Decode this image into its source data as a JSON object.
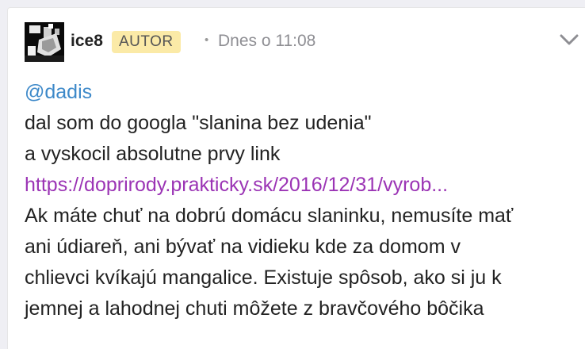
{
  "post": {
    "author": {
      "username": "ice8",
      "badge": "AUTOR"
    },
    "separator": "•",
    "timestamp": "Dnes o 11:08",
    "body": {
      "mention": "@dadis",
      "line1": "dal som do googla \"slanina bez udenia\"",
      "line2": "a vyskocil absolutne prvy link",
      "link_text": "https://doprirody.prakticky.sk/2016/12/31/vyrob...",
      "line3": "Ak máte chuť na dobrú domácu slaninku, nemusíte mať",
      "line4": "ani údiareň, ani bývať na vidieku kde za domom v",
      "line5": "chlievci kvíkajú mangalice. Existuje spôsob, ako si ju k",
      "line6": "jemnej a lahodnej chuti môžete z bravčového bôčika"
    }
  },
  "colors": {
    "mention": "#3d89c9",
    "link": "#9b34b5",
    "badge_bg": "#fbeaa7",
    "timestamp": "#8e8e93"
  },
  "icons": {
    "expand": "chevron-down-icon"
  }
}
